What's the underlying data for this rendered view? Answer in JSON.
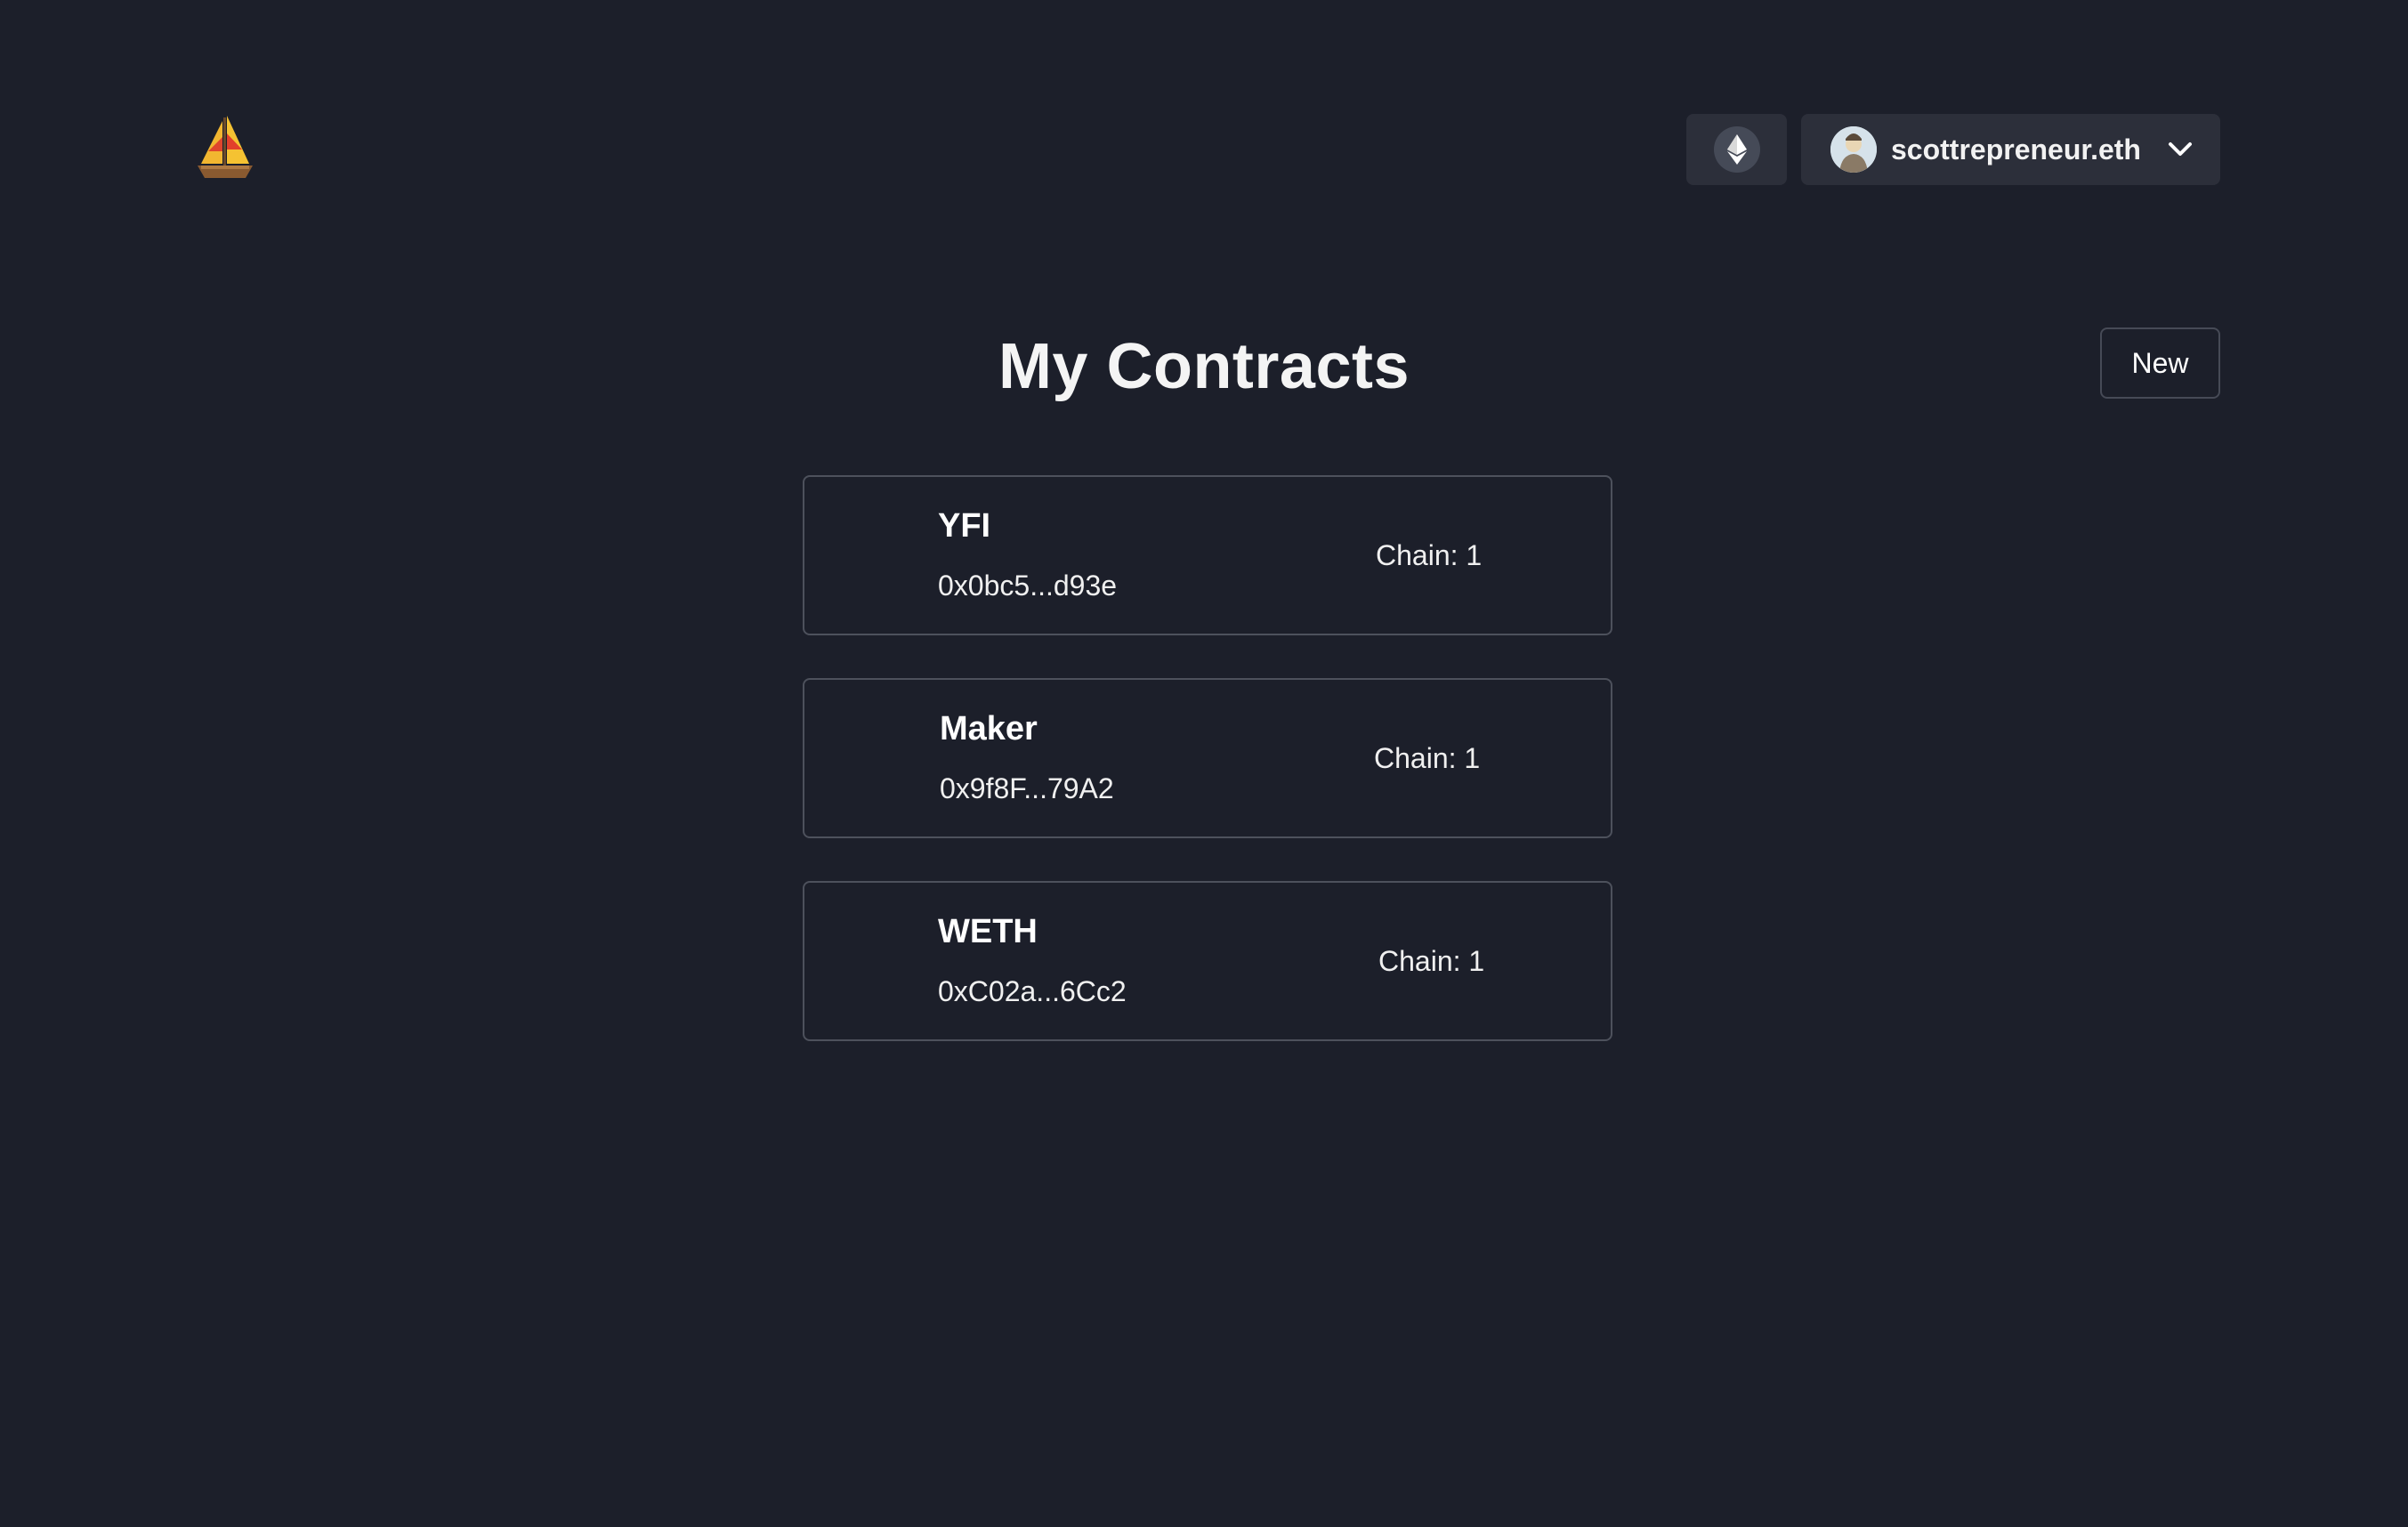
{
  "header": {
    "logo_icon": "sailboat-icon",
    "network_icon": "ethereum-icon",
    "account": {
      "avatar_icon": "avatar",
      "name": "scottrepreneur.eth",
      "dropdown_icon": "chevron-down-icon"
    }
  },
  "main": {
    "title": "My Contracts",
    "new_button_label": "New",
    "contracts": [
      {
        "name": "YFI",
        "address": "0x0bc5...d93e",
        "chain": "Chain: 1"
      },
      {
        "name": "Maker",
        "address": "0x9f8F...79A2",
        "chain": "Chain: 1"
      },
      {
        "name": "WETH",
        "address": "0xC02a...6Cc2",
        "chain": "Chain: 1"
      }
    ]
  },
  "colors": {
    "background": "#1c1f2a",
    "button_bg": "#2c2f3a",
    "border": "#4d515c",
    "text": "#ffffff"
  }
}
